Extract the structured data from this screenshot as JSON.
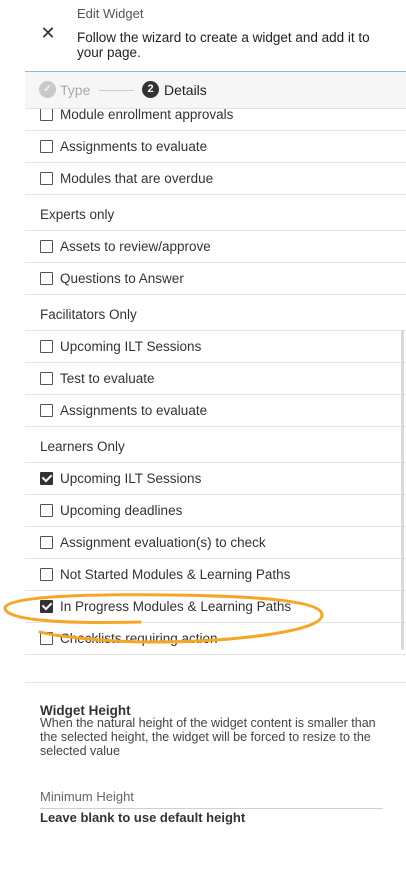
{
  "header": {
    "title": "Edit Widget",
    "description": "Follow the wizard to create a widget and add it to your page.",
    "close_icon": "close-icon"
  },
  "stepper": {
    "steps": [
      {
        "number": "✓",
        "label": "Type",
        "state": "done"
      },
      {
        "number": "2",
        "label": "Details",
        "state": "active"
      }
    ]
  },
  "list": {
    "rows": [
      {
        "kind": "item",
        "label": "Module enrollment approvals",
        "checked": false
      },
      {
        "kind": "item",
        "label": "Assignments to evaluate",
        "checked": false
      },
      {
        "kind": "item",
        "label": "Modules that are overdue",
        "checked": false
      },
      {
        "kind": "group",
        "label": "Experts only"
      },
      {
        "kind": "item",
        "label": "Assets to review/approve",
        "checked": false
      },
      {
        "kind": "item",
        "label": "Questions to Answer",
        "checked": false
      },
      {
        "kind": "group",
        "label": "Facilitators Only"
      },
      {
        "kind": "item",
        "label": "Upcoming ILT Sessions",
        "checked": false
      },
      {
        "kind": "item",
        "label": "Test to evaluate",
        "checked": false
      },
      {
        "kind": "item",
        "label": "Assignments to evaluate",
        "checked": false
      },
      {
        "kind": "group",
        "label": "Learners Only"
      },
      {
        "kind": "item",
        "label": "Upcoming ILT Sessions",
        "checked": true
      },
      {
        "kind": "item",
        "label": "Upcoming deadlines",
        "checked": false
      },
      {
        "kind": "item",
        "label": "Assignment evaluation(s) to check",
        "checked": false
      },
      {
        "kind": "item",
        "label": "Not Started Modules & Learning Paths",
        "checked": false
      },
      {
        "kind": "item",
        "label": "In Progress Modules & Learning Paths",
        "checked": true
      },
      {
        "kind": "item",
        "label": "Checklists requiring action",
        "checked": false
      }
    ]
  },
  "widget_height": {
    "title": "Widget Height",
    "description": "When the natural height of the widget content is smaller than the selected height, the widget will be forced to resize to the selected value",
    "min_height_label": "Minimum Height",
    "min_height_value": "",
    "hint": "Leave blank to use default height"
  },
  "colors": {
    "accent_line": "#8fb8d8",
    "annotation": "#f5a623",
    "active_step": "#333333",
    "done_step": "#c9c9c9"
  }
}
